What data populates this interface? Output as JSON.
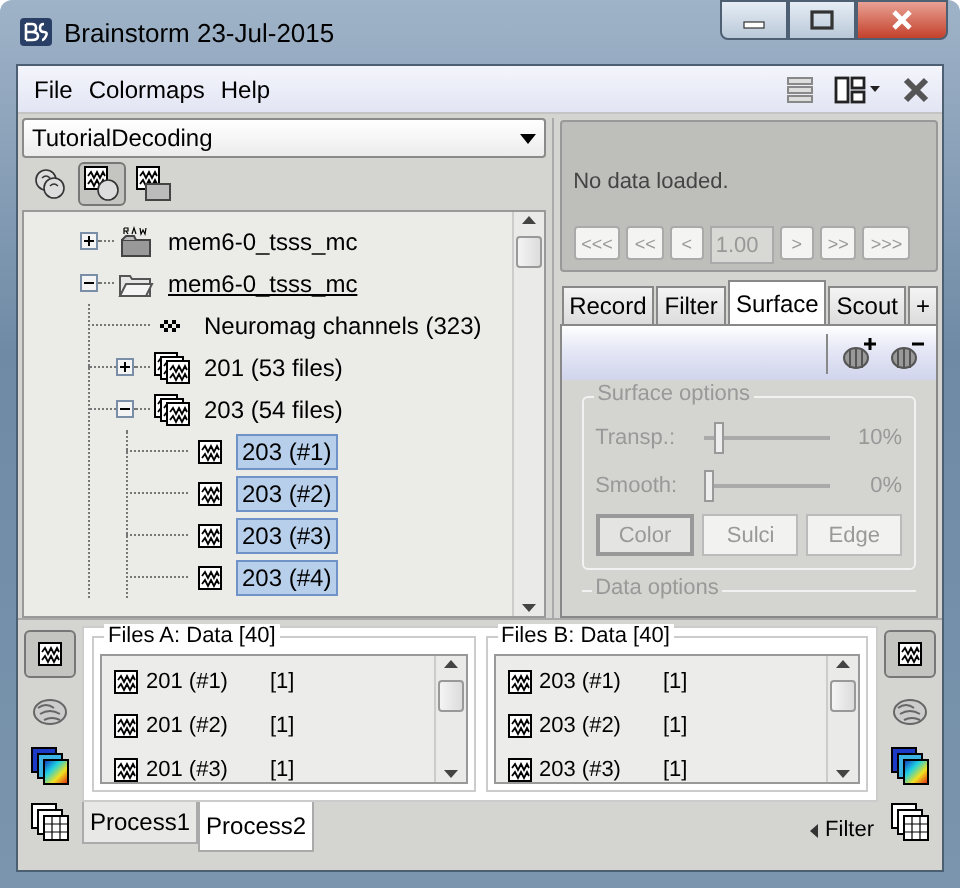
{
  "window": {
    "title": "Brainstorm 23-Jul-2015"
  },
  "menu": [
    {
      "label": "File"
    },
    {
      "label": "Colormaps"
    },
    {
      "label": "Help"
    }
  ],
  "protocol_selector": {
    "value": "TutorialDecoding"
  },
  "explorer_modes": [
    {
      "kind": "subjects",
      "selected": false
    },
    {
      "kind": "functional",
      "selected": true
    },
    {
      "kind": "study",
      "selected": false
    }
  ],
  "tree": [
    {
      "label": "mem6-0_tsss_mc",
      "kind": "raw",
      "expanded": false,
      "current": false,
      "selected": false
    },
    {
      "label": "mem6-0_tsss_mc",
      "kind": "folder",
      "expanded": true,
      "current": true,
      "selected": false,
      "children": [
        {
          "label": "Neuromag channels (323)",
          "kind": "channel",
          "selected": false
        },
        {
          "label": "201 (53 files)",
          "kind": "datalist",
          "expanded": false,
          "selected": false
        },
        {
          "label": "203 (54 files)",
          "kind": "datalist",
          "expanded": true,
          "selected": false,
          "children": [
            {
              "label": "203 (#1)",
              "kind": "data",
              "selected": true
            },
            {
              "label": "203 (#2)",
              "kind": "data",
              "selected": true
            },
            {
              "label": "203 (#3)",
              "kind": "data",
              "selected": true
            },
            {
              "label": "203 (#4)",
              "kind": "data",
              "selected": true
            }
          ]
        }
      ]
    }
  ],
  "time_panel": {
    "status": "No data loaded.",
    "disabled": true,
    "controls": [
      {
        "kind": "button",
        "label": "<<<"
      },
      {
        "kind": "button",
        "label": "<<"
      },
      {
        "kind": "button",
        "label": "<"
      },
      {
        "kind": "field",
        "value": "1.00"
      },
      {
        "kind": "button",
        "label": ">"
      },
      {
        "kind": "button",
        "label": ">>"
      },
      {
        "kind": "button",
        "label": ">>>"
      }
    ]
  },
  "tabs": [
    {
      "label": "Record",
      "selected": false
    },
    {
      "label": "Filter",
      "selected": false
    },
    {
      "label": "Surface",
      "selected": true
    },
    {
      "label": "Scout",
      "selected": false
    },
    {
      "label": "+",
      "selected": false
    }
  ],
  "surface_options": {
    "title": "Surface options",
    "disabled": true,
    "sliders": [
      {
        "label": "Transp.:",
        "level": 0.1,
        "reading": "10%"
      },
      {
        "label": "Smooth:",
        "level": 0,
        "reading": "0%"
      }
    ],
    "buttons": [
      {
        "label": "Color",
        "selected": true
      },
      {
        "label": "Sulci",
        "selected": false
      },
      {
        "label": "Edge",
        "selected": false
      }
    ]
  },
  "data_options": {
    "title": "Data options"
  },
  "left_tools": [
    {
      "kind": "data",
      "selected": true
    },
    {
      "kind": "surface",
      "selected": false
    },
    {
      "kind": "timefreq",
      "selected": false
    },
    {
      "kind": "matrix",
      "selected": false
    }
  ],
  "process_lists": [
    {
      "title": "Files A: Data [40]",
      "rows": [
        {
          "name": "201 (#1)",
          "count": "[1]"
        },
        {
          "name": "201 (#2)",
          "count": "[1]"
        },
        {
          "name": "201 (#3)",
          "count": "[1]"
        }
      ]
    },
    {
      "title": "Files B: Data [40]",
      "rows": [
        {
          "name": "203 (#1)",
          "count": "[1]"
        },
        {
          "name": "203 (#2)",
          "count": "[1]"
        },
        {
          "name": "203 (#3)",
          "count": "[1]"
        }
      ]
    }
  ],
  "right_tools": [
    {
      "kind": "data",
      "selected": true
    },
    {
      "kind": "surface",
      "selected": false
    },
    {
      "kind": "timefreq",
      "selected": false
    },
    {
      "kind": "matrix",
      "selected": false
    }
  ],
  "process_tabs": [
    {
      "label": "Process1",
      "selected": false
    },
    {
      "label": "Process2",
      "selected": true
    }
  ],
  "filter": {
    "label": "Filter"
  }
}
